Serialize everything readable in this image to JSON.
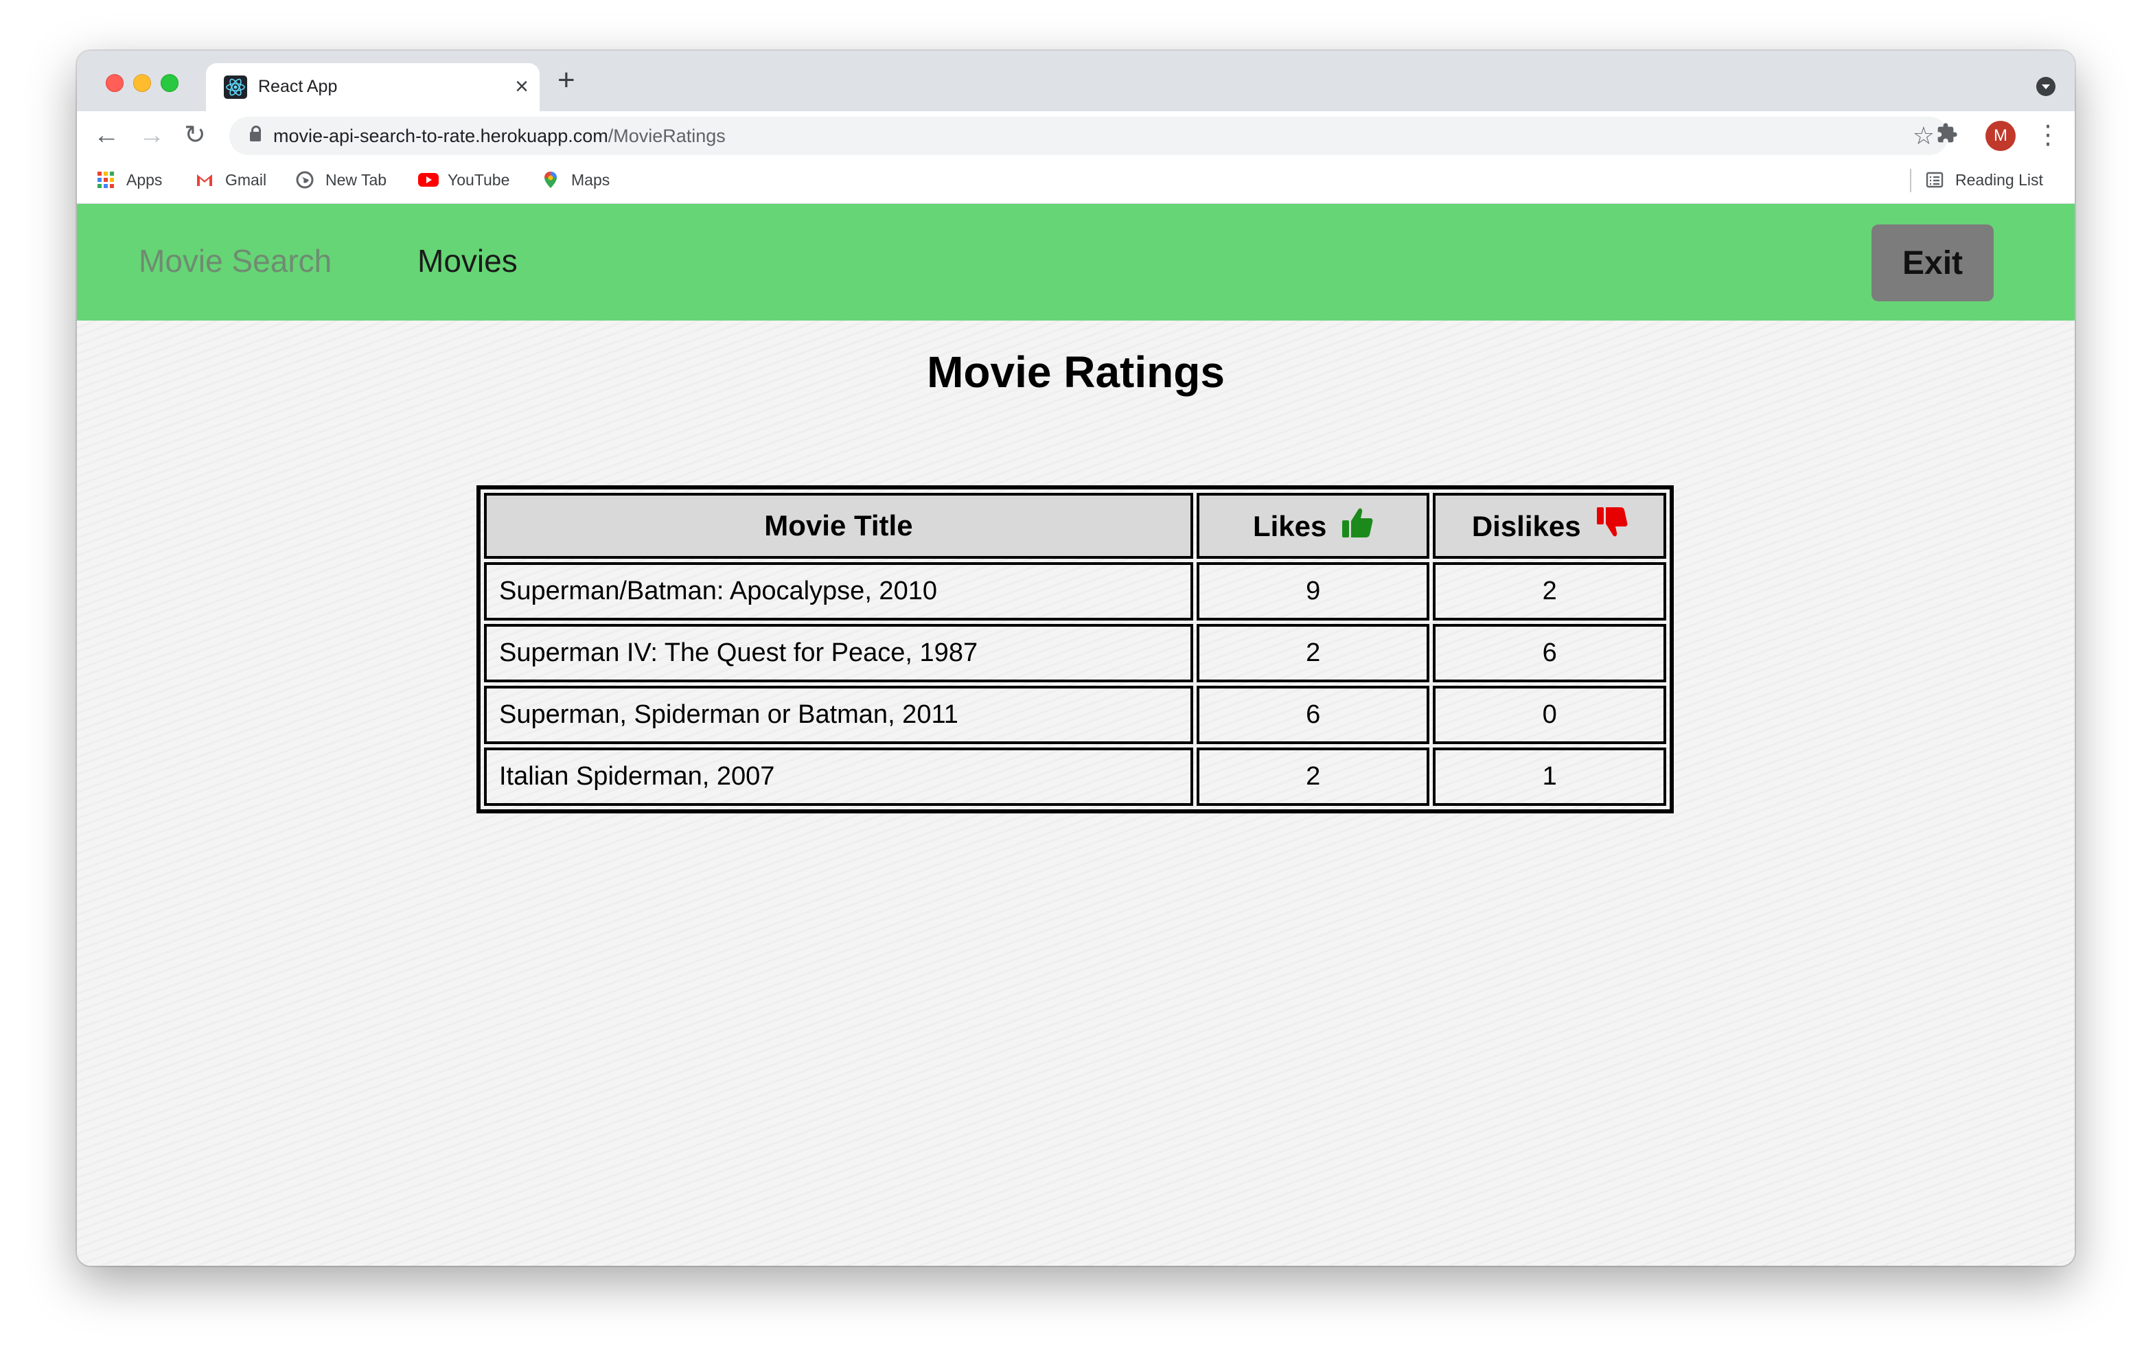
{
  "browser": {
    "tab_title": "React App",
    "tab_close": "×",
    "new_tab": "+",
    "url_host": "movie-api-search-to-rate.herokuapp.com",
    "url_path": "/MovieRatings",
    "avatar_letter": "M",
    "bookmarks": [
      {
        "label": "Apps",
        "icon": "apps-grid-icon"
      },
      {
        "label": "Gmail",
        "icon": "gmail-icon"
      },
      {
        "label": "New Tab",
        "icon": "globe-icon"
      },
      {
        "label": "YouTube",
        "icon": "youtube-icon"
      },
      {
        "label": "Maps",
        "icon": "maps-pin-icon"
      }
    ],
    "reading_list": "Reading List"
  },
  "nav": {
    "movie_search": "Movie Search",
    "movies": "Movies",
    "exit": "Exit"
  },
  "main": {
    "heading": "Movie Ratings",
    "table": {
      "headers": [
        "Movie Title",
        "Likes",
        "Dislikes"
      ],
      "rows": [
        [
          "Superman/Batman: Apocalypse, 2010",
          "9",
          "2"
        ],
        [
          "Superman IV: The Quest for Peace, 1987",
          "2",
          "6"
        ],
        [
          "Superman, Spiderman or Batman, 2011",
          "6",
          "0"
        ],
        [
          "Italian Spiderman, 2007",
          "2",
          "1"
        ]
      ]
    }
  },
  "colors": {
    "navbar": "#66d575",
    "exit_button": "#7c7c7c",
    "thumbs_up": "#1b8a1b",
    "thumbs_down": "#e60000"
  }
}
